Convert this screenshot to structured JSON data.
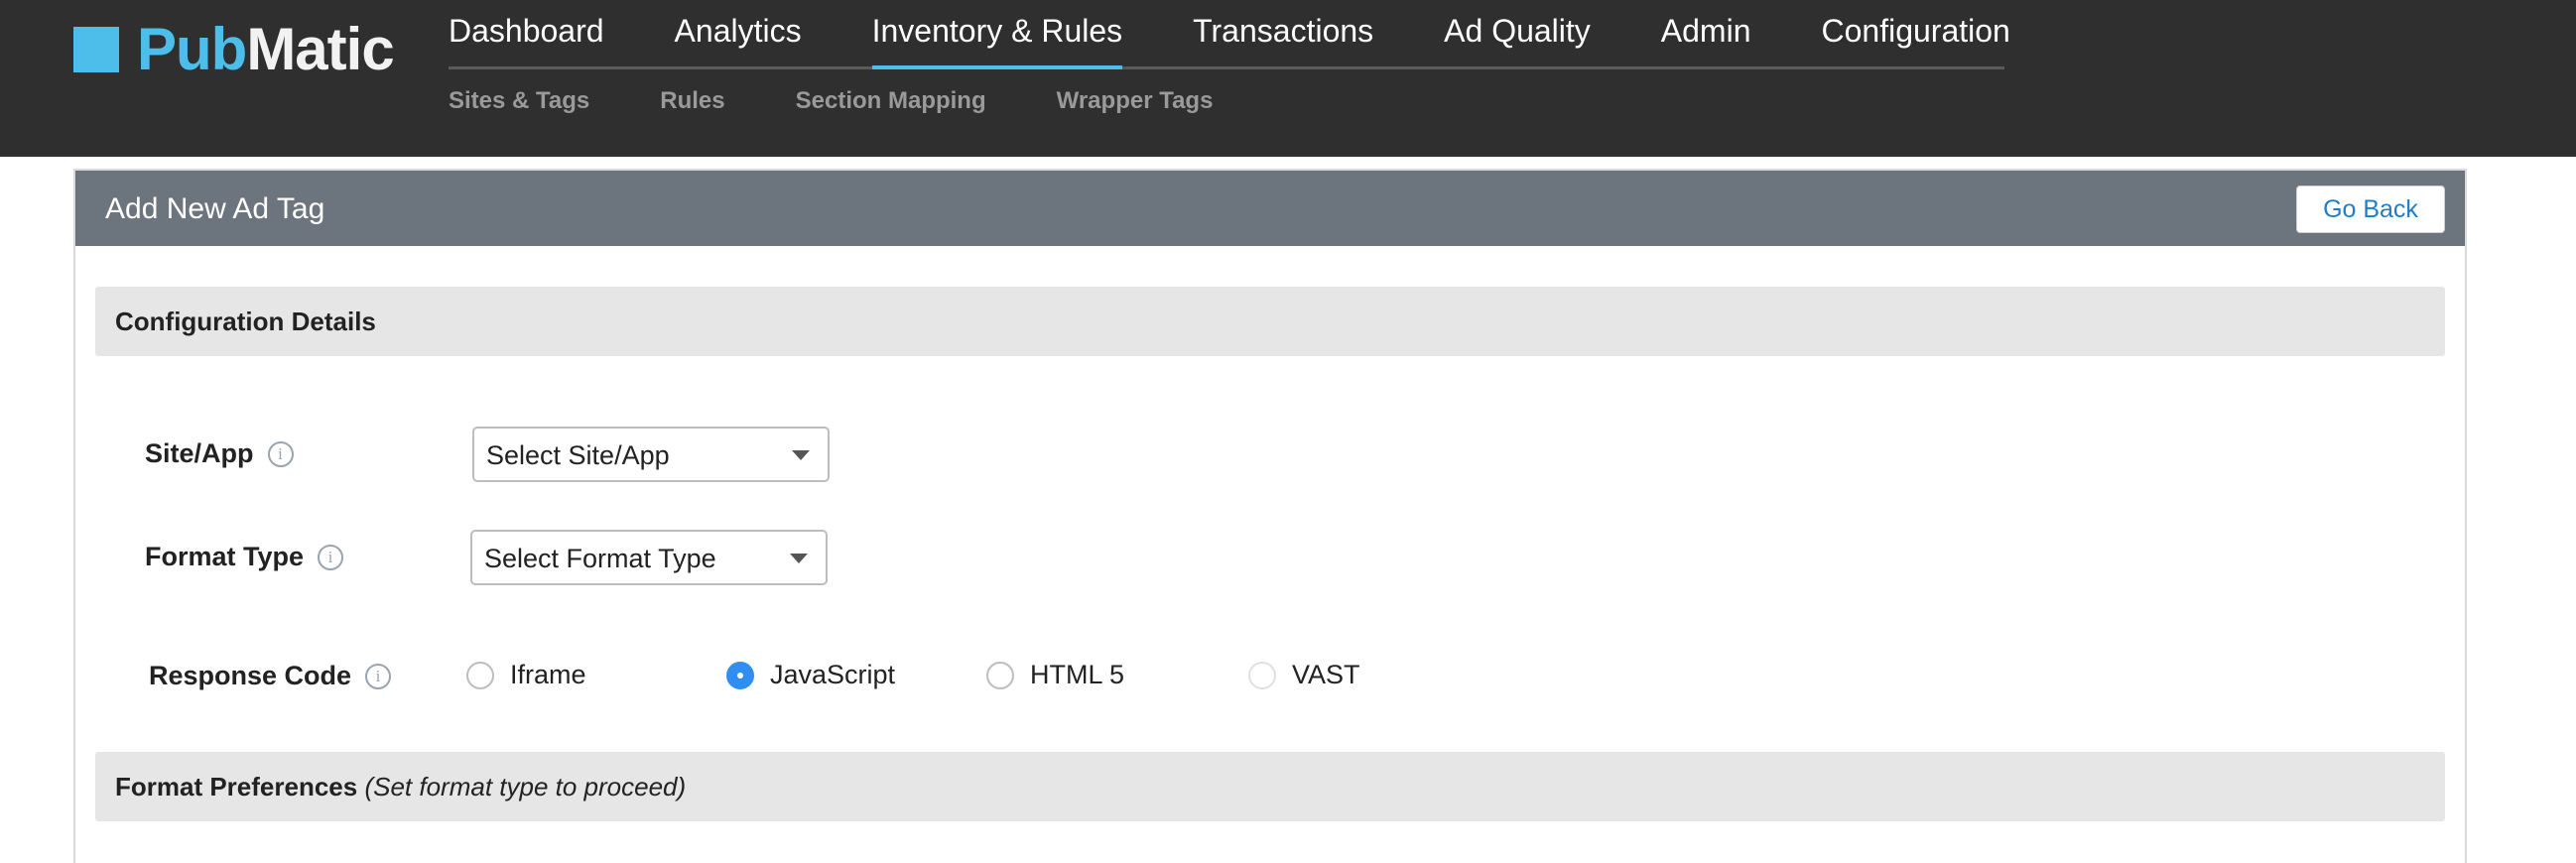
{
  "brand": {
    "part1": "Pub",
    "part2": "Matic"
  },
  "main_nav": [
    {
      "label": "Dashboard"
    },
    {
      "label": "Analytics"
    },
    {
      "label": "Inventory & Rules"
    },
    {
      "label": "Transactions"
    },
    {
      "label": "Ad Quality"
    },
    {
      "label": "Admin"
    },
    {
      "label": "Configuration"
    }
  ],
  "active_nav": "Inventory & Rules",
  "sub_nav": [
    {
      "label": "Sites & Tags"
    },
    {
      "label": "Rules"
    },
    {
      "label": "Section Mapping"
    },
    {
      "label": "Wrapper Tags"
    }
  ],
  "panel": {
    "title": "Add New Ad Tag",
    "go_back_label": "Go Back"
  },
  "config_section": {
    "title": "Configuration Details"
  },
  "form": {
    "site_app": {
      "label": "Site/App",
      "value": "Select Site/App"
    },
    "format_type": {
      "label": "Format Type",
      "value": "Select Format Type"
    },
    "response_code": {
      "label": "Response Code",
      "options": [
        "Iframe",
        "JavaScript",
        "HTML 5",
        "VAST"
      ],
      "selected": "JavaScript",
      "disabled": [
        "VAST"
      ]
    }
  },
  "format_section": {
    "title": "Format Preferences",
    "note": "(Set format type to proceed)"
  },
  "info_icon_glyph": "i",
  "colors": {
    "brand_blue": "#4dbde9",
    "nav_bg": "#2f2f2f",
    "header_gray": "#6c757d",
    "radio_selected": "#2f8ef0",
    "link_blue": "#1f7ec9"
  }
}
